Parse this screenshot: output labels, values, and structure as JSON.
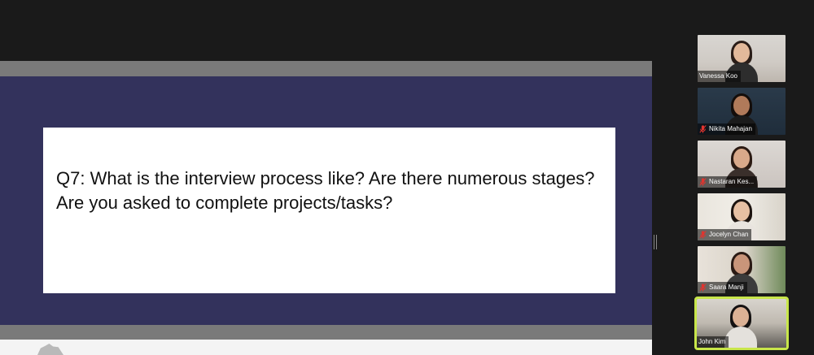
{
  "slide": {
    "text": "Q7: What is the interview process like? Are there numerous stages? Are you asked to complete projects/tasks?"
  },
  "colors": {
    "slide_background": "#33325c",
    "active_speaker": "#c8e64a",
    "muted_icon": "#e0342f"
  },
  "participants": [
    {
      "name": "Vanessa Koo",
      "muted": false,
      "active": false
    },
    {
      "name": "Nikita Mahajan",
      "muted": true,
      "active": false
    },
    {
      "name": "Nastaran Kes...",
      "muted": true,
      "active": false
    },
    {
      "name": "Jocelyn Chan",
      "muted": true,
      "active": false
    },
    {
      "name": "Saara Manji",
      "muted": true,
      "active": false
    },
    {
      "name": "John Kim",
      "muted": false,
      "active": true
    }
  ]
}
